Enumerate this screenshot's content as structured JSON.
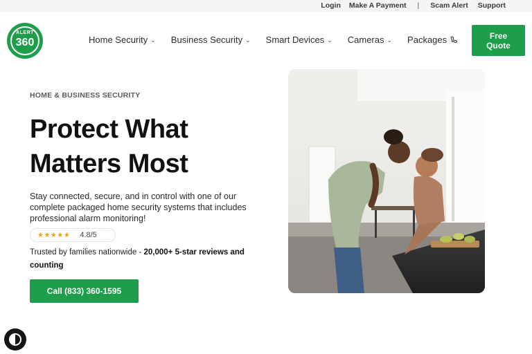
{
  "topbar": {
    "login": "Login",
    "make_payment": "Make A Payment",
    "separator": "|",
    "scam_alert": "Scam Alert",
    "support": "Support"
  },
  "logo": {
    "line1": "ALERT",
    "line2": "360"
  },
  "nav": {
    "items": [
      {
        "label": "Home Security"
      },
      {
        "label": "Business Security"
      },
      {
        "label": "Smart Devices"
      },
      {
        "label": "Cameras"
      },
      {
        "label": "Packages"
      }
    ],
    "phone_icon": "phone-icon",
    "quote_button": "Free\nQuote"
  },
  "hero": {
    "eyebrow": "HOME & BUSINESS SECURITY",
    "headline": "Protect What Matters Most",
    "subtext": "Stay connected, secure, and in control with one of our complete packaged home security systems that includes professional alarm monitoring!",
    "rating": {
      "stars": "★★★★★",
      "score": "4.8/5"
    },
    "trusted_prefix": "Trusted by families nationwide - ",
    "trusted_bold": "20,000+ 5-star reviews and counting",
    "call_button": "Call (833) 360-1595"
  },
  "colors": {
    "brand_green": "#1e9e4a",
    "star_gold": "#e8a317"
  }
}
